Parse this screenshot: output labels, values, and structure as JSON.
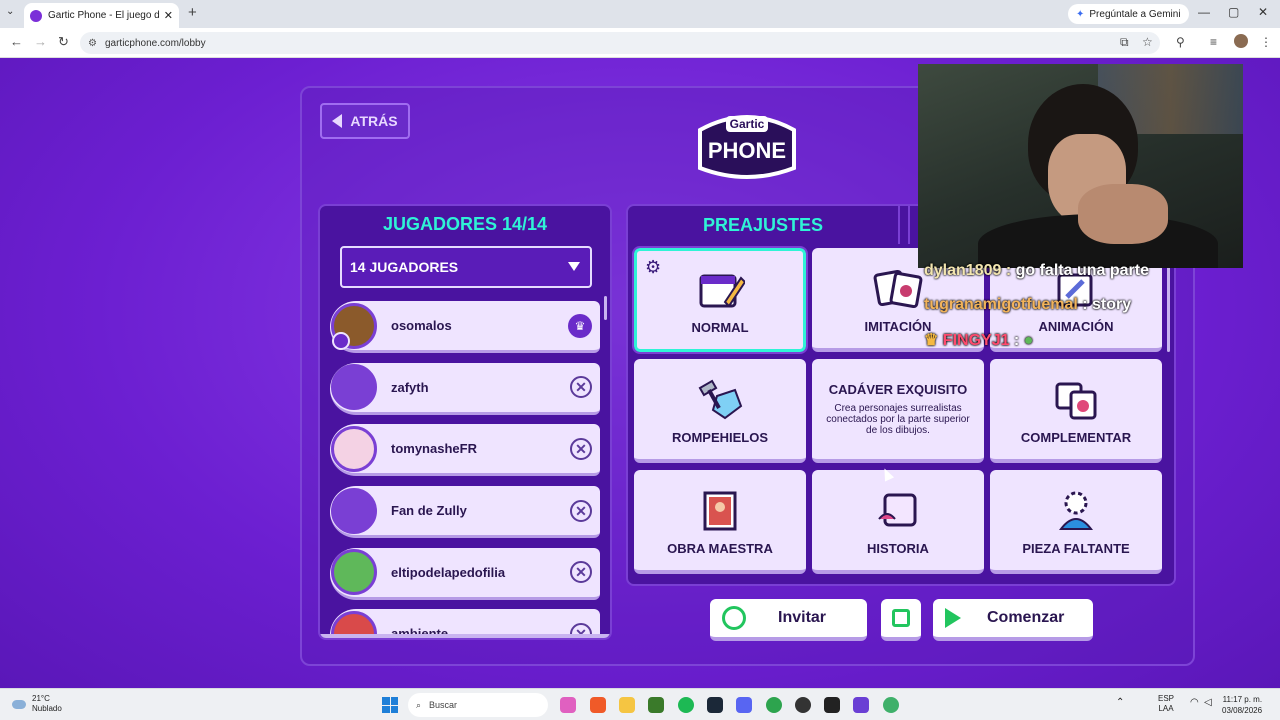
{
  "browser": {
    "tab_title": "Gartic Phone - El juego del tele",
    "tab_close": "✕",
    "new_tab": "+",
    "url": "garticphone.com/lobby",
    "gemini_label": "Pregúntale a Gemini",
    "win_min": "—",
    "win_max": "▢",
    "win_close": "✕"
  },
  "lobby": {
    "back_label": "ATRÁS",
    "logo_top": "Gartic",
    "logo_bottom": "PHONE",
    "players_title": "JUGADORES 14/14",
    "players_select": "14 JUGADORES",
    "players": [
      {
        "name": "osomalos",
        "action": "♛",
        "color": "#8b5a2b"
      },
      {
        "name": "zafyth",
        "action": "✕",
        "color": "#7a3fd4"
      },
      {
        "name": "tomynasheFR",
        "action": "✕",
        "color": "#f4d2e4"
      },
      {
        "name": "Fan de Zully",
        "action": "✕",
        "color": "#7a3fd4"
      },
      {
        "name": "eltipodelapedofilia",
        "action": "✕",
        "color": "#5fb85a"
      },
      {
        "name": "ambiente",
        "action": "✕",
        "color": "#d94a4a"
      }
    ],
    "presets_title": "PREAJUSTES",
    "presets": [
      {
        "label": "NORMAL",
        "icon": "calendar-pencil-icon",
        "color": "#6a2bc9"
      },
      {
        "label": "IMITACIÓN",
        "icon": "cards-icon",
        "color": "#c83c6e"
      },
      {
        "label": "ANIMACIÓN",
        "icon": "animation-icon",
        "color": "#5b6bd8"
      },
      {
        "label": "ROMPEHIELOS",
        "icon": "hammer-ice-icon",
        "color": "#38a7e0"
      },
      {
        "label": "CADÁVER EXQUISITO",
        "desc": "Crea personajes surrealistas conectados por la parte superior de los dibujos."
      },
      {
        "label": "COMPLEMENTAR",
        "icon": "complement-icon",
        "color": "#e0487a"
      },
      {
        "label": "OBRA MAESTRA",
        "icon": "masterpiece-icon",
        "color": "#d9534f"
      },
      {
        "label": "HISTORIA",
        "icon": "scroll-icon",
        "color": "#e04a8a"
      },
      {
        "label": "PIEZA FALTANTE",
        "icon": "puzzle-icon",
        "color": "#2b8fe0"
      }
    ],
    "invite_label": "Invitar",
    "start_label": "Comenzar"
  },
  "stream_chat": [
    {
      "user": "dylan1809",
      "sep": " : ",
      "text": "go falta una parte",
      "color": "#f3e6b0"
    },
    {
      "user": "tugranamigotfuemal",
      "sep": " : ",
      "text": "story",
      "color": "#f2b35a"
    },
    {
      "user": "FINGYJ1",
      "sep": " : ",
      "text": "",
      "color": "#ff4b6e"
    }
  ],
  "taskbar": {
    "temp": "21°C",
    "weather": "Nublado",
    "search_placeholder": "Buscar",
    "lang_top": "ESP",
    "lang_bottom": "LAA",
    "time": "11:17 p. m.",
    "date": "03/08/2026"
  }
}
